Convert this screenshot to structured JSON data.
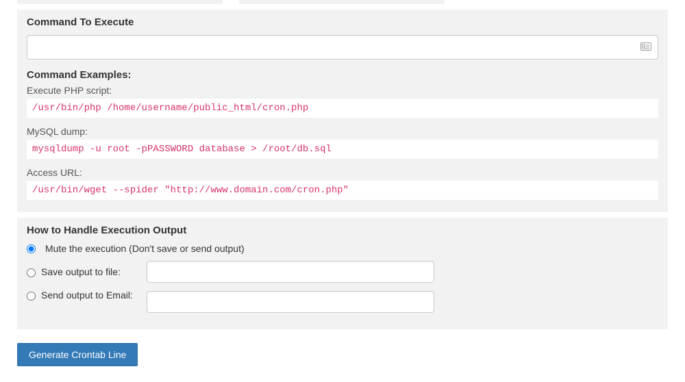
{
  "commandSection": {
    "title": "Command To Execute",
    "inputValue": "",
    "examplesHeading": "Command Examples:",
    "examples": [
      {
        "label": "Execute PHP script:",
        "code": "/usr/bin/php /home/username/public_html/cron.php"
      },
      {
        "label": "MySQL dump:",
        "code": "mysqldump -u root -pPASSWORD database > /root/db.sql"
      },
      {
        "label": "Access URL:",
        "code": "/usr/bin/wget --spider \"http://www.domain.com/cron.php\""
      }
    ]
  },
  "outputSection": {
    "title": "How to Handle Execution Output",
    "options": {
      "mute": "Mute the execution (Don't save or send output)",
      "saveFile": "Save output to file:",
      "sendEmail": "Send output to Email:"
    },
    "saveFileValue": "",
    "sendEmailValue": ""
  },
  "buttons": {
    "generate": "Generate Crontab Line"
  }
}
